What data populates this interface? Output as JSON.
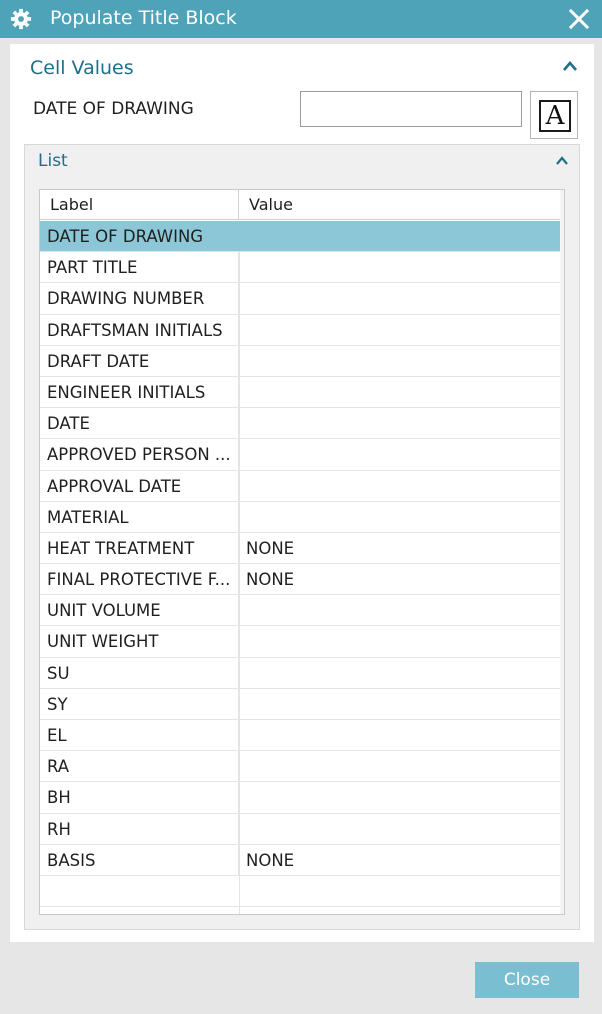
{
  "window": {
    "title": "Populate Title Block",
    "icon": "gear-icon",
    "close_icon": "close-icon"
  },
  "section": {
    "label": "Cell Values",
    "chevron": "chevron-up-icon"
  },
  "field": {
    "label": "DATE OF DRAWING",
    "value": "",
    "font_button_glyph": "A"
  },
  "list": {
    "label": "List",
    "chevron": "chevron-up-icon",
    "columns": [
      "Label",
      "Value"
    ],
    "rows": [
      {
        "label": "DATE OF DRAWING",
        "value": "",
        "selected": true
      },
      {
        "label": "PART TITLE",
        "value": ""
      },
      {
        "label": "DRAWING NUMBER",
        "value": ""
      },
      {
        "label": "DRAFTSMAN INITIALS",
        "value": ""
      },
      {
        "label": "DRAFT DATE",
        "value": ""
      },
      {
        "label": "ENGINEER INITIALS",
        "value": ""
      },
      {
        "label": "DATE",
        "value": ""
      },
      {
        "label": "APPROVED PERSON ...",
        "value": ""
      },
      {
        "label": "APPROVAL DATE",
        "value": ""
      },
      {
        "label": "MATERIAL",
        "value": ""
      },
      {
        "label": "HEAT TREATMENT",
        "value": "NONE"
      },
      {
        "label": "FINAL PROTECTIVE F...",
        "value": "NONE"
      },
      {
        "label": "UNIT VOLUME",
        "value": ""
      },
      {
        "label": "UNIT WEIGHT",
        "value": ""
      },
      {
        "label": "SU",
        "value": ""
      },
      {
        "label": "SY",
        "value": ""
      },
      {
        "label": "EL",
        "value": ""
      },
      {
        "label": "RA",
        "value": ""
      },
      {
        "label": "BH",
        "value": ""
      },
      {
        "label": "RH",
        "value": ""
      },
      {
        "label": "BASIS",
        "value": "NONE"
      }
    ]
  },
  "footer": {
    "close_label": "Close"
  },
  "colors": {
    "title_bar": "#4fa3b8",
    "accent_text": "#1e6f8a",
    "selected_row": "#8cc7d8",
    "close_button": "#79bfd1"
  }
}
